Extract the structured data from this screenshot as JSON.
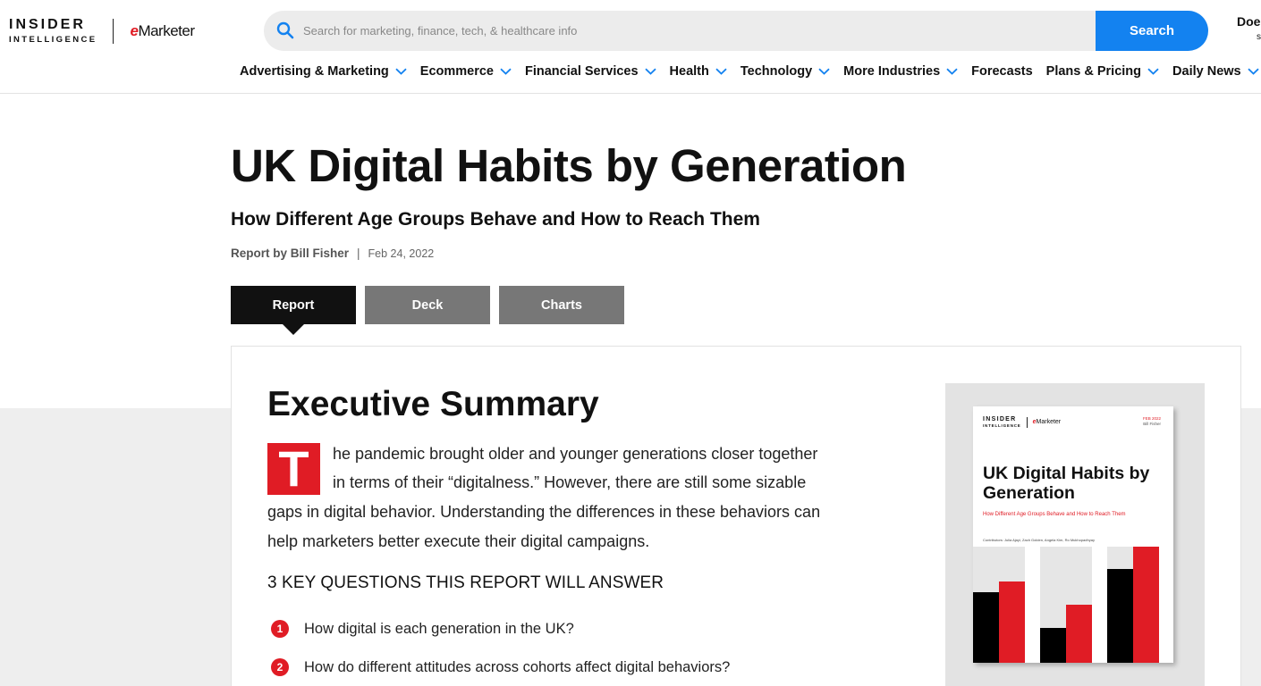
{
  "header": {
    "logo_line1": "INSIDER",
    "logo_line2": "INTELLIGENCE",
    "logo_brand_e": "e",
    "logo_brand_rest": "Marketer",
    "search_placeholder": "Search for marketing, finance, tech, & healthcare info",
    "search_button": "Search",
    "user_line1": "Doe",
    "user_line2": "s"
  },
  "nav": {
    "items": [
      {
        "label": "Advertising & Marketing",
        "dropdown": true
      },
      {
        "label": "Ecommerce",
        "dropdown": true
      },
      {
        "label": "Financial Services",
        "dropdown": true
      },
      {
        "label": "Health",
        "dropdown": true
      },
      {
        "label": "Technology",
        "dropdown": true
      },
      {
        "label": "More Industries",
        "dropdown": true
      },
      {
        "label": "Forecasts",
        "dropdown": false
      },
      {
        "label": "Plans & Pricing",
        "dropdown": true
      },
      {
        "label": "Daily News",
        "dropdown": true
      }
    ]
  },
  "article": {
    "title": "UK Digital Habits by Generation",
    "subtitle": "How Different Age Groups Behave and How to Reach Them",
    "byline_prefix": "Report by Bill Fisher",
    "byline_sep": "|",
    "date": "Feb 24, 2022",
    "tabs": [
      {
        "label": "Report",
        "active": true
      },
      {
        "label": "Deck",
        "active": false
      },
      {
        "label": "Charts",
        "active": false
      }
    ]
  },
  "summary": {
    "heading": "Executive Summary",
    "dropcap": "T",
    "lines": [
      "he pandemic brought older and younger generations closer together",
      "in terms of their “digitalness.” However, there are still some sizable",
      "gaps in digital behavior. Understanding the differences in these behaviors can",
      "help marketers better execute their digital campaigns."
    ],
    "key_questions_heading": "3 KEY QUESTIONS THIS REPORT WILL ANSWER",
    "questions": [
      {
        "num": "1",
        "text": "How digital is each generation in the UK?"
      },
      {
        "num": "2",
        "text": "How do different attitudes across cohorts affect digital behaviors?"
      }
    ]
  },
  "cover": {
    "logo_line1": "INSIDER",
    "logo_line2": "INTELLIGENCE",
    "brand_e": "e",
    "brand_rest": "Marketer",
    "date": "FEB 2022",
    "author": "Bill Fisher",
    "title": "UK Digital Habits by Generation",
    "subtitle": "How Different Age Groups Behave and How to Reach Them",
    "contributors": "Contributors: Julia Ajayi, Zach Golden, Angela Kim, Ro Mukhopadhyay"
  },
  "colors": {
    "accent_red": "#e01c25",
    "search_blue": "#1382f0",
    "tab_active": "#111111",
    "tab_inactive": "#777777"
  }
}
